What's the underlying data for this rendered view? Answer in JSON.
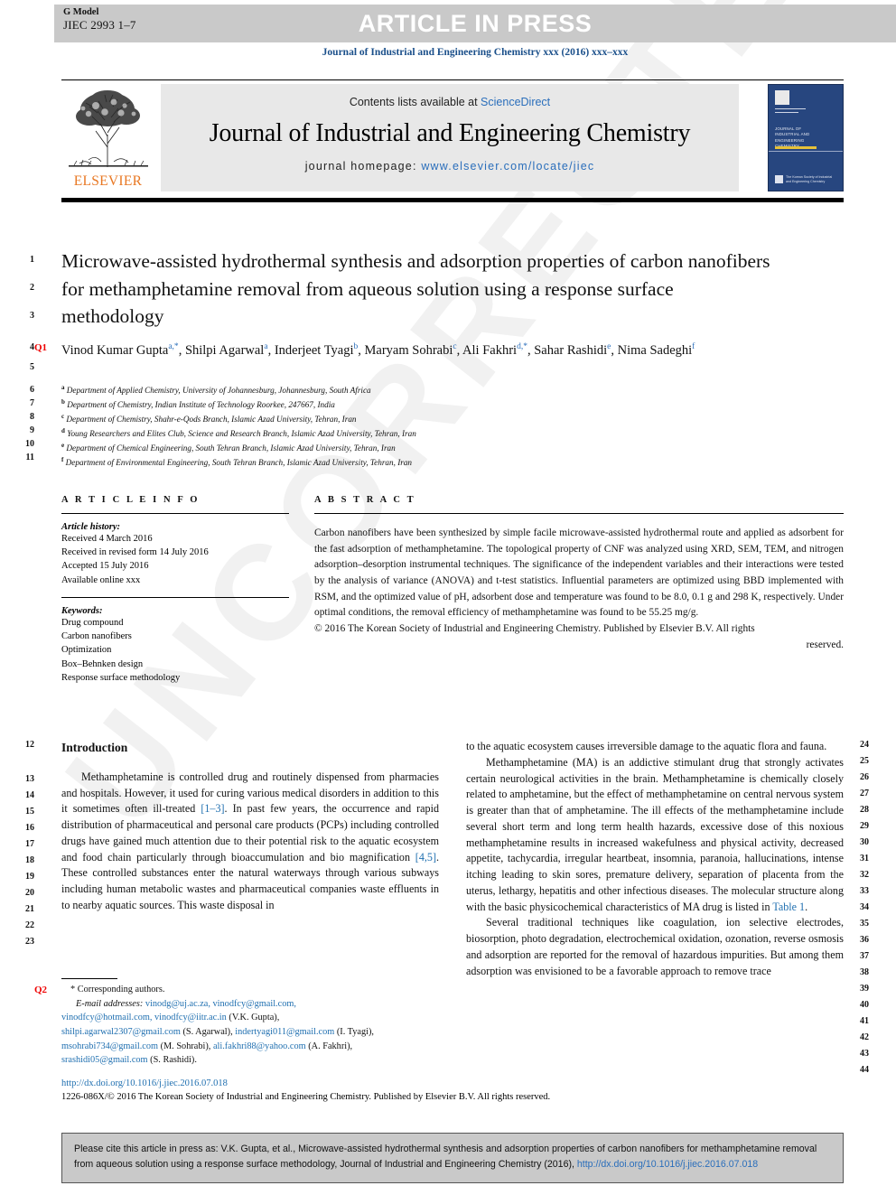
{
  "header": {
    "g_model_label": "G Model",
    "g_model_id": "JIEC 2993 1–7",
    "article_in_press": "ARTICLE IN PRESS",
    "running_head": "Journal of Industrial and Engineering Chemistry xxx (2016) xxx–xxx"
  },
  "masthead": {
    "contents_prefix": "Contents lists available at ",
    "sciencedirect": "ScienceDirect",
    "journal_title": "Journal of Industrial and Engineering Chemistry",
    "homepage_prefix": "journal homepage: ",
    "homepage_url": "www.elsevier.com/locate/jiec",
    "publisher": "ELSEVIER",
    "cover_title": "JOURNAL OF INDUSTRIAL AND ENGINEERING CHEMISTRY",
    "cover_footer": "The Korean Society of Industrial and Engineering Chemistry"
  },
  "article": {
    "title": "Microwave-assisted hydrothermal synthesis and adsorption properties of carbon nanofibers for methamphetamine removal from aqueous solution using a response surface methodology",
    "authors_line1_part1": "Vinod Kumar Gupta",
    "authors_sup1": "a,*",
    "authors_line1_part2": ", Shilpi Agarwal",
    "authors_sup2": "a",
    "authors_line1_part3": ", Inderjeet Tyagi",
    "authors_sup3": "b",
    "authors_line1_part4": ", Maryam Sohrabi",
    "authors_sup4": "c",
    "authors_line1_part5": ", Ali Fakhri",
    "authors_sup5": "d,*",
    "authors_line2_part1": ", Sahar Rashidi",
    "authors_sup6": "e",
    "authors_line2_part2": ", Nima Sadeghi",
    "authors_sup7": "f",
    "affiliations": [
      {
        "mark": "a",
        "text": "Department of Applied Chemistry, University of Johannesburg, Johannesburg, South Africa"
      },
      {
        "mark": "b",
        "text": "Department of Chemistry, Indian Institute of Technology Roorkee, 247667, India"
      },
      {
        "mark": "c",
        "text": "Department of Chemistry, Shahr-e-Qods Branch, Islamic Azad University, Tehran, Iran"
      },
      {
        "mark": "d",
        "text": "Young Researchers and Elites Club, Science and Research Branch, Islamic Azad University, Tehran, Iran"
      },
      {
        "mark": "e",
        "text": "Department of Chemical Engineering, South Tehran Branch, Islamic Azad University, Tehran, Iran"
      },
      {
        "mark": "f",
        "text": "Department of Environmental Engineering, South Tehran Branch, Islamic Azad University, Tehran, Iran"
      }
    ]
  },
  "article_info": {
    "heading": "A R T I C L E   I N F O",
    "history_label": "Article history:",
    "history": [
      "Received 4 March 2016",
      "Received in revised form 14 July 2016",
      "Accepted 15 July 2016",
      "Available online xxx"
    ],
    "keywords_label": "Keywords:",
    "keywords": [
      "Drug compound",
      "Carbon nanofibers",
      "Optimization",
      "Box–Behnken design",
      "Response surface methodology"
    ]
  },
  "abstract": {
    "heading": "A B S T R A C T",
    "body": "Carbon nanofibers have been synthesized by simple facile microwave-assisted hydrothermal route and applied as adsorbent for the fast adsorption of methamphetamine. The topological property of CNF was analyzed using XRD, SEM, TEM, and nitrogen adsorption–desorption instrumental techniques. The significance of the independent variables and their interactions were tested by the analysis of variance (ANOVA) and t-test statistics. Influential parameters are optimized using BBD implemented with RSM, and the optimized value of pH, adsorbent dose and temperature was found to be 8.0, 0.1 g and 298 K, respectively. Under optimal conditions, the removal efficiency of methamphetamine was found to be 55.25 mg/g.",
    "copyright": "© 2016 The Korean Society of Industrial and Engineering Chemistry. Published by Elsevier B.V. All rights",
    "copyright_last": "reserved."
  },
  "body": {
    "intro_heading": "Introduction",
    "left_paragraph_1_a": "Methamphetamine is controlled drug and routinely dispensed from pharmacies and hospitals. However, it used for curing various medical disorders in addition to this it sometimes often ill-treated ",
    "left_ref_1": "[1–3]",
    "left_paragraph_1_b": ". In past few years, the occurrence and rapid distribution of pharmaceutical and personal care products (PCPs) including controlled drugs have gained much attention due to their potential risk to the aquatic ecosystem and food chain particularly through bioaccumulation and bio magnification ",
    "left_ref_2": "[4,5]",
    "left_paragraph_1_c": ". These controlled substances enter the natural waterways through various subways including human metabolic wastes and pharmaceutical companies waste effluents in to nearby aquatic sources. This waste disposal in",
    "right_paragraph_0": "to the aquatic ecosystem causes irreversible damage to the aquatic flora and fauna.",
    "right_paragraph_1_a": "Methamphetamine (MA) is an addictive stimulant drug that strongly activates certain neurological activities in the brain. Methamphetamine is chemically closely related to amphetamine, but the effect of methamphetamine on central nervous system is greater than that of amphetamine. The ill effects of the methamphetamine include several short term and long term health hazards, excessive dose of this noxious methamphetamine results in increased wakefulness and physical activity, decreased appetite, tachycardia, irregular heartbeat, insomnia, paranoia, hallucinations, intense itching leading to skin sores, premature delivery, separation of placenta from the uterus, lethargy, hepatitis and other infectious diseases. The molecular structure along with the basic physicochemical characteristics of MA drug is listed in ",
    "right_ref_table": "Table 1",
    "right_paragraph_1_b": ".",
    "right_paragraph_2": "Several traditional techniques like coagulation, ion selective electrodes, biosorption, photo degradation, electrochemical oxidation, ozonation, reverse osmosis and adsorption are reported for the removal of hazardous impurities. But among them adsorption was envisioned to be a favorable approach to remove trace"
  },
  "footnotes": {
    "star": "*",
    "corresponding": "Corresponding authors.",
    "email_label": "E-mail addresses:",
    "emails_line1": "vinodg@uj.ac.za, vinodfcy@gmail.com,",
    "emails_line2_a": "vinodfcy@hotmail.com, vinodfcy@iitr.ac.in",
    "emails_line2_b": " (V.K. Gupta),",
    "emails_line3_a": "shilpi.agarwal2307@gmail.com",
    "emails_line3_b": " (S. Agarwal), ",
    "emails_line3_c": "indertyagi011@gmail.com",
    "emails_line3_d": " (I. Tyagi),",
    "emails_line4_a": "msohrabi734@gmail.com",
    "emails_line4_b": " (M. Sohrabi), ",
    "emails_line4_c": "ali.fakhri88@yahoo.com",
    "emails_line4_d": " (A. Fakhri),",
    "emails_line5_a": "srashidi05@gmail.com",
    "emails_line5_b": " (S. Rashidi)."
  },
  "doi_block": {
    "doi_url": "http://dx.doi.org/10.1016/j.jiec.2016.07.018",
    "issn_line": "1226-086X/© 2016 The Korean Society of Industrial and Engineering Chemistry. Published by Elsevier B.V. All rights reserved."
  },
  "cite_box": {
    "text": "Please cite this article in press as: V.K. Gupta, et al., Microwave-assisted hydrothermal synthesis and adsorption properties of carbon nanofibers for methamphetamine removal from aqueous solution using a response surface methodology, Journal of Industrial and Engineering Chemistry (2016), ",
    "doi": "http://dx.doi.org/10.1016/j.jiec.2016.07.018"
  },
  "markers": {
    "q1": "Q1",
    "q2": "Q2",
    "watermark": "UNCORRECTED PROOF"
  },
  "line_numbers_left": [
    "1",
    "2",
    "3",
    "4",
    "5",
    "6",
    "7",
    "8",
    "9",
    "10",
    "11",
    "12",
    "13",
    "14",
    "15",
    "16",
    "17",
    "18",
    "19",
    "20",
    "21",
    "22",
    "23"
  ],
  "line_numbers_right": [
    "24",
    "25",
    "26",
    "27",
    "28",
    "29",
    "30",
    "31",
    "32",
    "33",
    "34",
    "35",
    "36",
    "37",
    "38",
    "39",
    "40",
    "41",
    "42",
    "43",
    "44"
  ],
  "colors": {
    "link": "#2a6ebb",
    "ref": "#1f6fb0",
    "marker_red": "#ee0000",
    "band_gray": "#c9c9c9",
    "elsevier_orange": "#e87722",
    "cover_blue": "#27467f"
  }
}
